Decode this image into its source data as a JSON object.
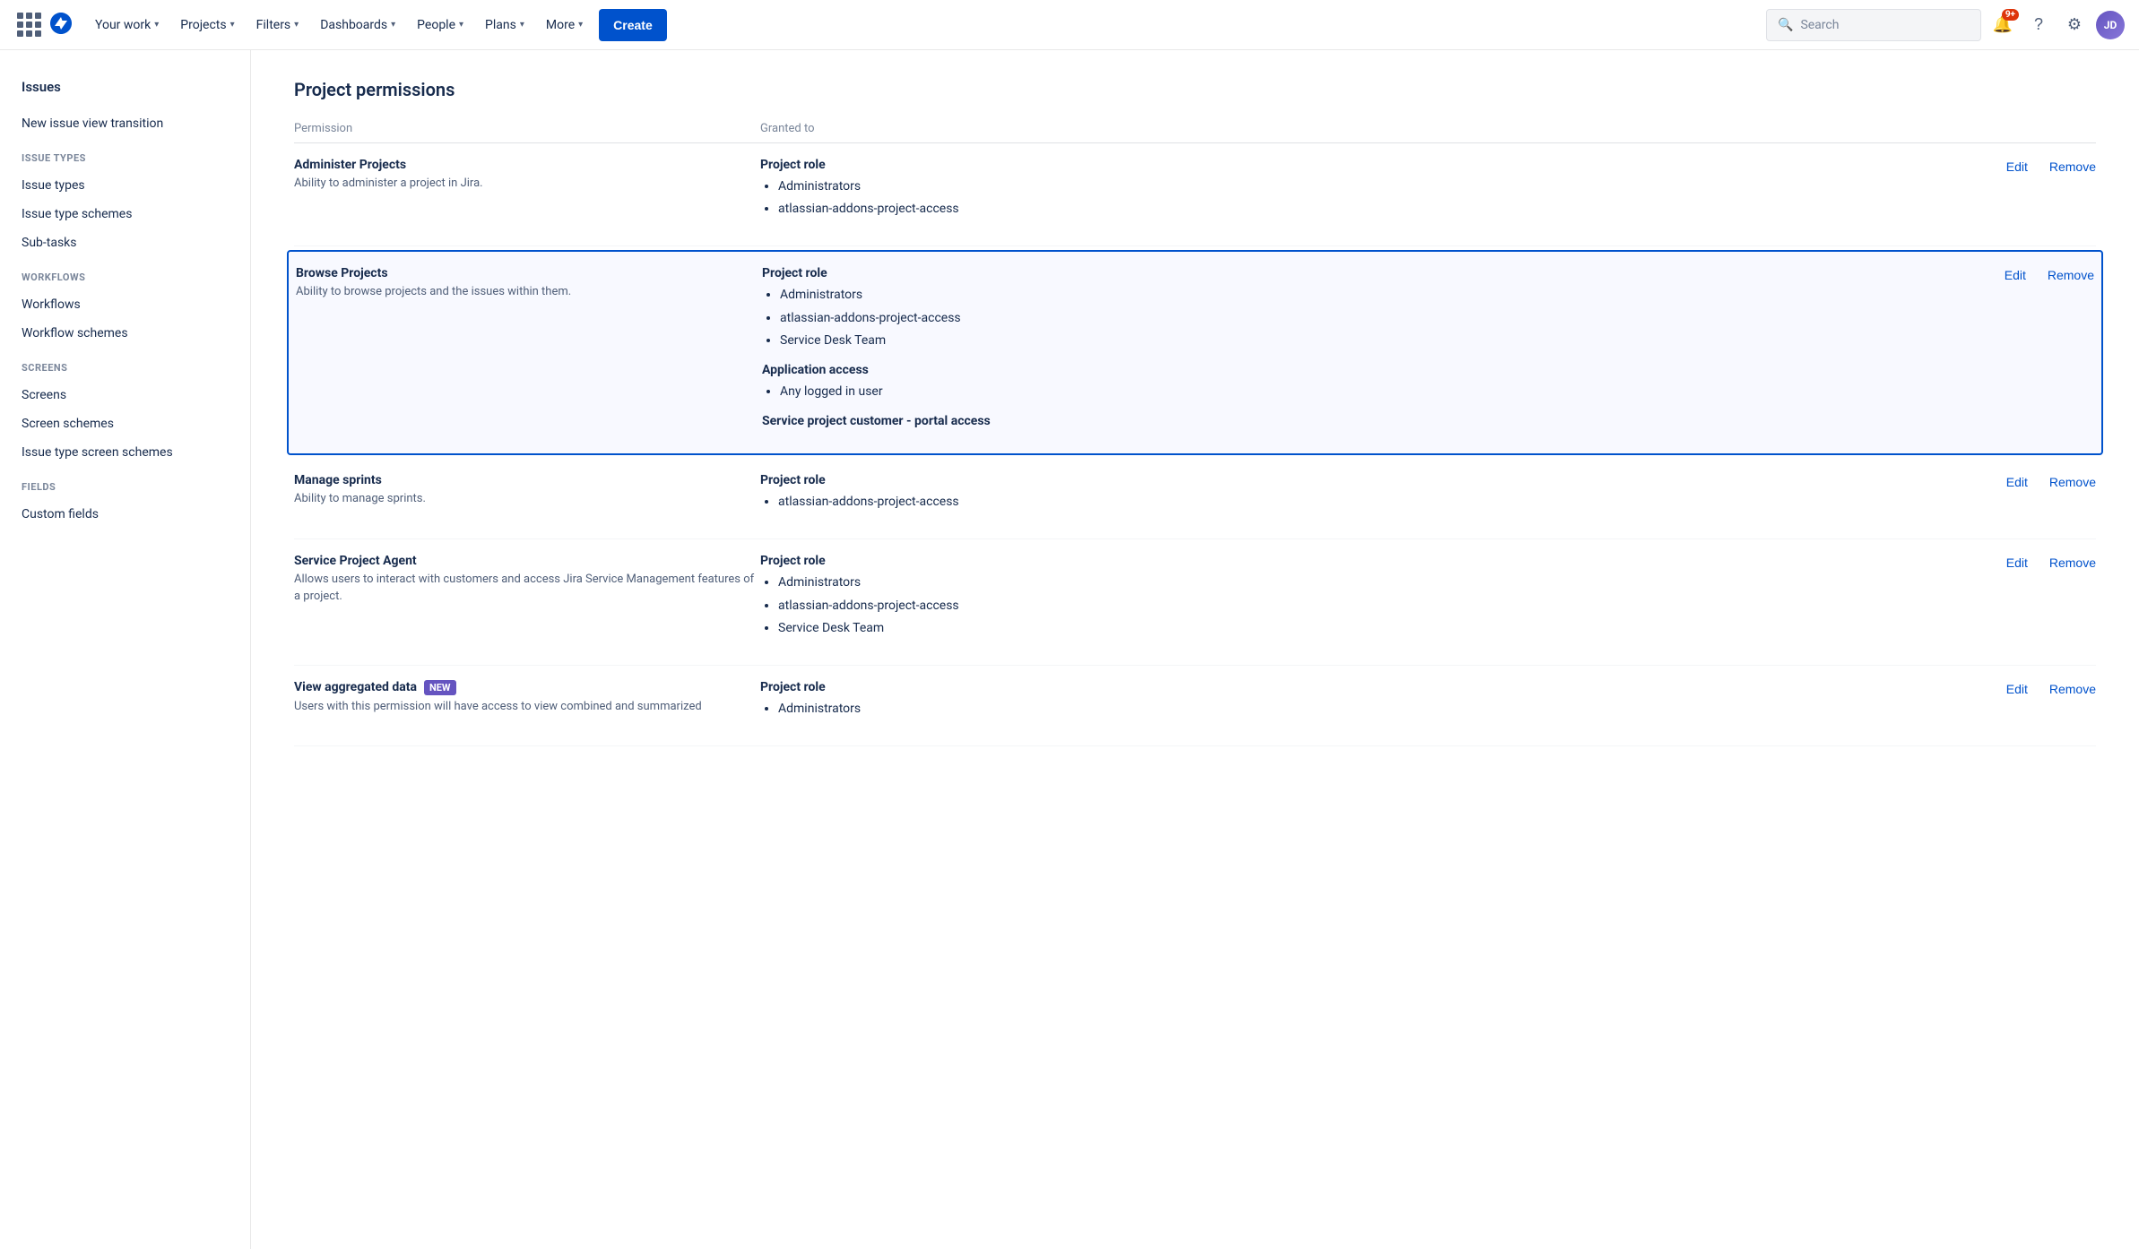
{
  "topnav": {
    "logo_alt": "Jira",
    "nav_items": [
      {
        "label": "Your work",
        "has_chevron": true
      },
      {
        "label": "Projects",
        "has_chevron": true
      },
      {
        "label": "Filters",
        "has_chevron": true
      },
      {
        "label": "Dashboards",
        "has_chevron": true
      },
      {
        "label": "People",
        "has_chevron": true
      },
      {
        "label": "Plans",
        "has_chevron": true
      },
      {
        "label": "More",
        "has_chevron": true
      }
    ],
    "create_label": "Create",
    "search_placeholder": "Search",
    "notif_count": "9+",
    "avatar_initials": "JD"
  },
  "sidebar": {
    "top_section": "Issues",
    "items": [
      {
        "label": "New issue view transition",
        "section": null
      },
      {
        "label": "ISSUE TYPES",
        "type": "section_header"
      },
      {
        "label": "Issue types",
        "section": "issue_types"
      },
      {
        "label": "Issue type schemes",
        "section": "issue_types"
      },
      {
        "label": "Sub-tasks",
        "section": "issue_types"
      },
      {
        "label": "WORKFLOWS",
        "type": "section_header"
      },
      {
        "label": "Workflows",
        "section": "workflows"
      },
      {
        "label": "Workflow schemes",
        "section": "workflows"
      },
      {
        "label": "SCREENS",
        "type": "section_header"
      },
      {
        "label": "Screens",
        "section": "screens"
      },
      {
        "label": "Screen schemes",
        "section": "screens"
      },
      {
        "label": "Issue type screen schemes",
        "section": "screens"
      },
      {
        "label": "FIELDS",
        "type": "section_header"
      },
      {
        "label": "Custom fields",
        "section": "fields"
      }
    ]
  },
  "main": {
    "page_title": "Project permissions",
    "table_headers": {
      "permission": "Permission",
      "granted_to": "Granted to"
    },
    "permissions": [
      {
        "name": "Administer Projects",
        "description": "Ability to administer a project in Jira.",
        "highlighted": false,
        "granted_sections": [
          {
            "title": "Project role",
            "items": [
              "Administrators",
              "atlassian-addons-project-access"
            ]
          }
        ],
        "actions": [
          "Edit",
          "Remove"
        ]
      },
      {
        "name": "Browse Projects",
        "description": "Ability to browse projects and the issues within them.",
        "highlighted": true,
        "granted_sections": [
          {
            "title": "Project role",
            "items": [
              "Administrators",
              "atlassian-addons-project-access",
              "Service Desk Team"
            ]
          },
          {
            "title": "Application access",
            "items": [
              "Any logged in user"
            ]
          },
          {
            "title": "Service project customer - portal access",
            "items": []
          }
        ],
        "actions": [
          "Edit",
          "Remove"
        ]
      },
      {
        "name": "Manage sprints",
        "description": "Ability to manage sprints.",
        "highlighted": false,
        "granted_sections": [
          {
            "title": "Project role",
            "items": [
              "atlassian-addons-project-access"
            ]
          }
        ],
        "actions": [
          "Edit",
          "Remove"
        ]
      },
      {
        "name": "Service Project Agent",
        "description": "Allows users to interact with customers and access Jira Service Management features of a project.",
        "highlighted": false,
        "granted_sections": [
          {
            "title": "Project role",
            "items": [
              "Administrators",
              "atlassian-addons-project-access",
              "Service Desk Team"
            ]
          }
        ],
        "actions": [
          "Edit",
          "Remove"
        ]
      },
      {
        "name": "View aggregated data",
        "description": "Users with this permission will have access to view combined and summarized",
        "highlighted": false,
        "badge": "NEW",
        "granted_sections": [
          {
            "title": "Project role",
            "items": [
              "Administrators"
            ]
          }
        ],
        "actions": [
          "Edit",
          "Remove"
        ]
      }
    ]
  }
}
